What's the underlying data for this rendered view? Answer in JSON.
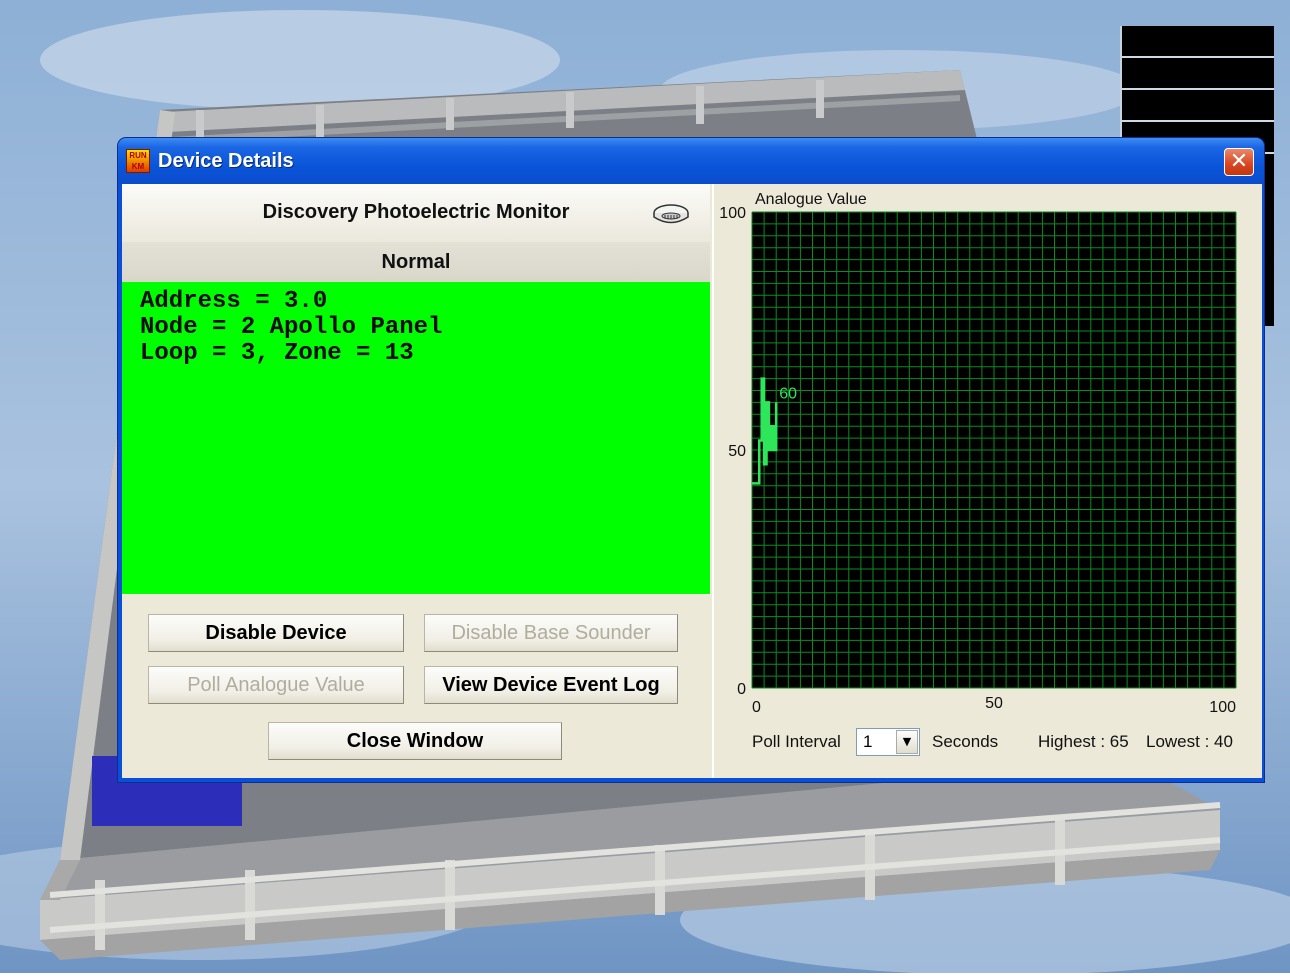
{
  "window": {
    "title": "Device Details",
    "app_icon_text": [
      "RUN",
      "KM"
    ],
    "close_glyph": "✕"
  },
  "device": {
    "name": "Discovery Photoelectric Monitor",
    "icon": "smoke-detector-icon",
    "status": "Normal",
    "status_color": "#00ff00",
    "info_lines": [
      "Address = 3.0",
      "Node = 2 Apollo Panel",
      "Loop = 3, Zone = 13"
    ]
  },
  "buttons": {
    "disable_device": "Disable Device",
    "disable_base_sounder": "Disable Base Sounder",
    "poll_analogue_value": "Poll Analogue Value",
    "view_device_event_log": "View Device Event Log",
    "close_window": "Close Window"
  },
  "graph": {
    "poll_interval_label": "Poll Interval",
    "poll_interval_value": "1",
    "seconds_label": "Seconds",
    "highest_label": "Highest : 65",
    "lowest_label": "Lowest : 40"
  },
  "chart_data": {
    "type": "line",
    "title": "Analogue Value",
    "xlim": [
      0,
      100
    ],
    "ylim": [
      0,
      100
    ],
    "x_ticks": [
      "0",
      "50",
      "100"
    ],
    "y_ticks": [
      "100",
      "50",
      "0"
    ],
    "grid": true,
    "background": "#000000",
    "grid_color": "#0b8c1e",
    "line_color": "#2ee65a",
    "series": [
      {
        "x": [
          0,
          1,
          1.5,
          2,
          2.5,
          3,
          3.5,
          4,
          4.5,
          5
        ],
        "y": [
          43,
          43,
          52,
          65,
          47,
          60,
          50,
          55,
          50,
          60
        ]
      }
    ],
    "annotations": [
      {
        "x": 5,
        "y": 60,
        "text": "60"
      }
    ]
  }
}
